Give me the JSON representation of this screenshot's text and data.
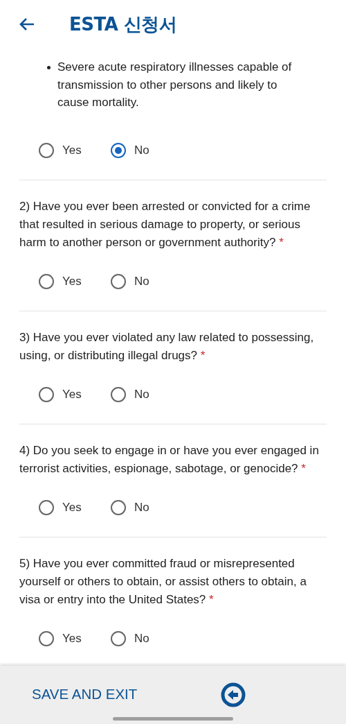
{
  "header": {
    "title": "ESTA 신청서"
  },
  "sections": [
    {
      "kind": "bullets",
      "bullets": [
        "Severe acute respiratory illnesses capable of transmission to other persons and likely to cause mortality."
      ],
      "options": [
        {
          "label": "Yes",
          "selected": false
        },
        {
          "label": "No",
          "selected": true
        }
      ]
    },
    {
      "kind": "question",
      "text": "2) Have you ever been arrested or convicted for a crime that resulted in serious damage to property, or serious harm to another person or government authority?",
      "required_mark": "*",
      "options": [
        {
          "label": "Yes",
          "selected": false
        },
        {
          "label": "No",
          "selected": false
        }
      ]
    },
    {
      "kind": "question",
      "text": "3) Have you ever violated any law related to possessing, using, or distributing illegal drugs?",
      "required_mark": "*",
      "options": [
        {
          "label": "Yes",
          "selected": false
        },
        {
          "label": "No",
          "selected": false
        }
      ]
    },
    {
      "kind": "question",
      "text": "4) Do you seek to engage in or have you ever engaged in terrorist activities, espionage, sabotage, or genocide?",
      "required_mark": "*",
      "options": [
        {
          "label": "Yes",
          "selected": false
        },
        {
          "label": "No",
          "selected": false
        }
      ]
    },
    {
      "kind": "question",
      "text": "5) Have you ever committed fraud or misrepresented yourself or others to obtain, or assist others to obtain, a visa or entry into the United States?",
      "required_mark": "*",
      "options": [
        {
          "label": "Yes",
          "selected": false
        },
        {
          "label": "No",
          "selected": false
        }
      ]
    }
  ],
  "footer": {
    "save_label": "SAVE AND EXIT"
  }
}
